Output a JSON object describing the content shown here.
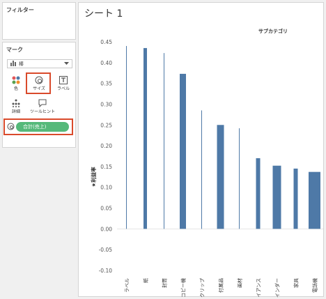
{
  "filters": {
    "title": "フィルター"
  },
  "marks": {
    "title": "マーク",
    "type_label": "棒",
    "buttons": [
      {
        "label": "色"
      },
      {
        "label": "サイズ"
      },
      {
        "label": "ラベル"
      },
      {
        "label": "詳細"
      },
      {
        "label": "ツールヒント"
      }
    ],
    "pill_label": "合計(売上)",
    "highlight_color": "#d94a2b",
    "pill_color": "#55b97a"
  },
  "sheet": {
    "title": "シート 1",
    "column_header": "サブカテゴリ"
  },
  "chart_data": {
    "type": "bar",
    "ylabel": "★利益率",
    "ylim": [
      -0.1,
      0.45
    ],
    "yticks": [
      "-0.10",
      "-0.05",
      "0.00",
      "0.05",
      "0.10",
      "0.15",
      "0.20",
      "0.25",
      "0.30",
      "0.35",
      "0.40",
      "0.45"
    ],
    "grid": false,
    "bar_color": "#4e79a7",
    "categories": [
      "ラベル",
      "紙",
      "封筒",
      "コピー機",
      "クリップ",
      "付属品",
      "画材",
      "アプライアンス",
      "バインダー",
      "家具",
      "電話機"
    ],
    "x_labels": [
      "ラベル",
      "紙",
      "封筒",
      "コピー機",
      "クリップ",
      "付属品",
      "画材",
      "イアンス",
      "インダー",
      "家具",
      "電話機"
    ],
    "values": [
      0.44,
      0.435,
      0.423,
      0.373,
      0.285,
      0.25,
      0.242,
      0.17,
      0.152,
      0.145,
      0.137
    ],
    "size_encoding": [
      1,
      5,
      1,
      9,
      1,
      10,
      1,
      6,
      12,
      6,
      17
    ]
  }
}
